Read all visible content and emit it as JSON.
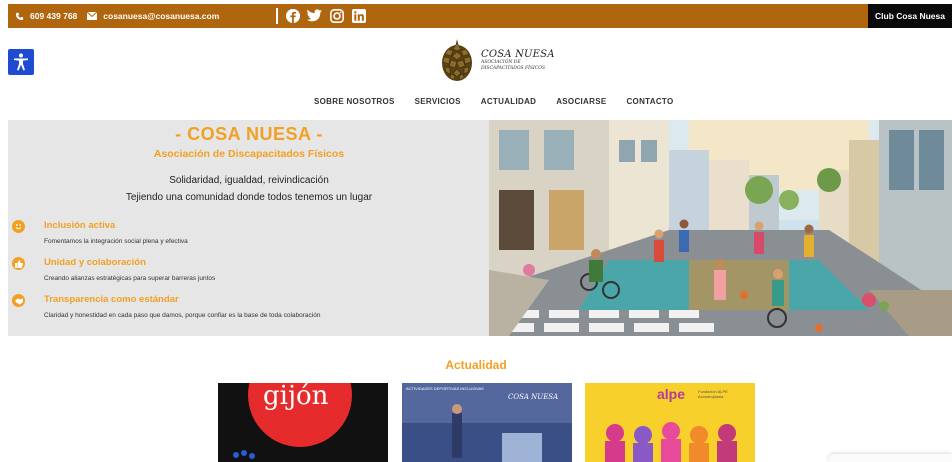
{
  "topbar": {
    "phone": "609 439 768",
    "email": "cosanuesa@cosanuesa.com",
    "club_button": "Club Cosa Nuesa",
    "social_icons": [
      "facebook-icon",
      "twitter-icon",
      "instagram-icon",
      "linkedin-icon"
    ],
    "color": "#b0660f"
  },
  "logo": {
    "name": "COSA NUESA",
    "line1": "ASOCIACIÓN DE",
    "line2": "DISCAPACITADOS FÍSICOS"
  },
  "nav": {
    "items": [
      "SOBRE NOSOTROS",
      "SERVICIOS",
      "ACTUALIDAD",
      "ASOCIARSE",
      "CONTACTO"
    ]
  },
  "hero": {
    "title": "- COSA NUESA -",
    "subtitle": "Asociación de Discapacitados Físicos",
    "line1": "Solidaridad, igualdad, reivindicación",
    "line2": "Tejiendo una comunidad donde todos tenemos un lugar",
    "features": [
      {
        "title": "Inclusión activa",
        "desc": "Fomentamos la integración social plena y efectiva",
        "icon": "smile-icon"
      },
      {
        "title": "Unidad y colaboración",
        "desc": "Creando alianzas estratégicas para superar barreras juntos",
        "icon": "thumbs-up-icon"
      },
      {
        "title": "Transparencia como estándar",
        "desc": "Claridad y honestidad en cada paso que damos, porque confiar es la base de toda colaboración",
        "icon": "handshake-icon"
      }
    ],
    "accent": "#f2a023"
  },
  "news": {
    "title": "Actualidad",
    "cards": [
      {
        "logo_text": "gijón"
      },
      {
        "header": "ACTIVIDADES DEPORTIVAS INCLUSIVAS",
        "brand": "COSA NUESA"
      },
      {
        "brand": "alpe",
        "brand_sub": "Fundación ALPE Acondroplasia"
      }
    ]
  }
}
